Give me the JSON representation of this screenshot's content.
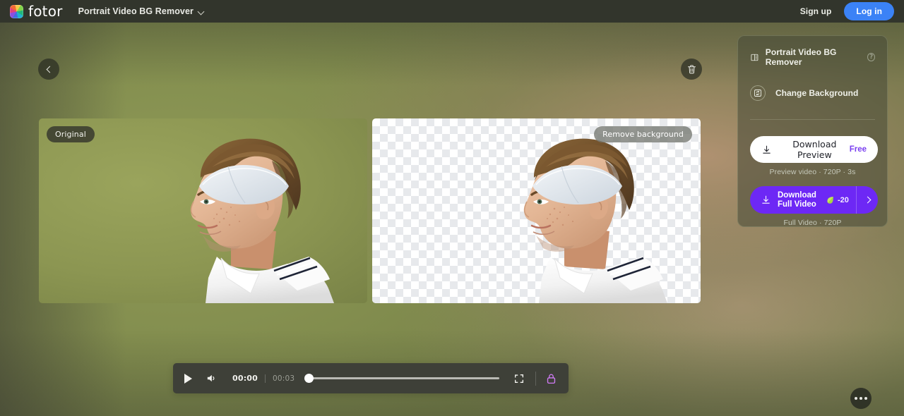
{
  "header": {
    "logo_word": "fotor",
    "logo_icon": "color-wheel-logo",
    "doc_title": "Portrait Video BG Remover",
    "dropdown_icon": "chevron-down-icon",
    "signup_label": "Sign up",
    "login_label": "Log in",
    "login_color": "#3b82f6"
  },
  "canvas": {
    "back_icon": "chevron-left-icon",
    "delete_icon": "trash-icon",
    "panes": [
      {
        "badge": "Original",
        "kind": "original-photo"
      },
      {
        "badge": "Remove background",
        "kind": "transparent-result"
      }
    ]
  },
  "sidebar": {
    "title": "Portrait Video BG Remover",
    "title_icon": "before-after-split-icon",
    "help_icon": "?",
    "actions": [
      {
        "label": "Change Background",
        "icon": "change-background-icon"
      }
    ],
    "download_preview": {
      "label": "Download Preview",
      "icon": "download-icon",
      "badge": "Free",
      "badge_color": "#7a3ff0",
      "caption": "Preview video · 720P · 3s"
    },
    "download_full": {
      "label": "Download Full Video",
      "label_line1": "Download Full",
      "label_line2": "Video",
      "icon": "download-icon",
      "credit_icon": "leaf-credit-icon",
      "credit_value": "-20",
      "arrow_icon": "chevron-right-icon",
      "caption": "Full Video · 720P",
      "accent_color": "#6d28f5"
    }
  },
  "player": {
    "play_icon": "play-icon",
    "volume_icon": "volume-on-icon",
    "current_time": "00:00",
    "duration": "00:03",
    "progress_percent": 0,
    "fullscreen_icon": "fullscreen-icon",
    "lock_icon": "lock-icon",
    "lock_color": "#d07bf5"
  },
  "floating": {
    "more_icon": "more-horizontal-icon"
  }
}
